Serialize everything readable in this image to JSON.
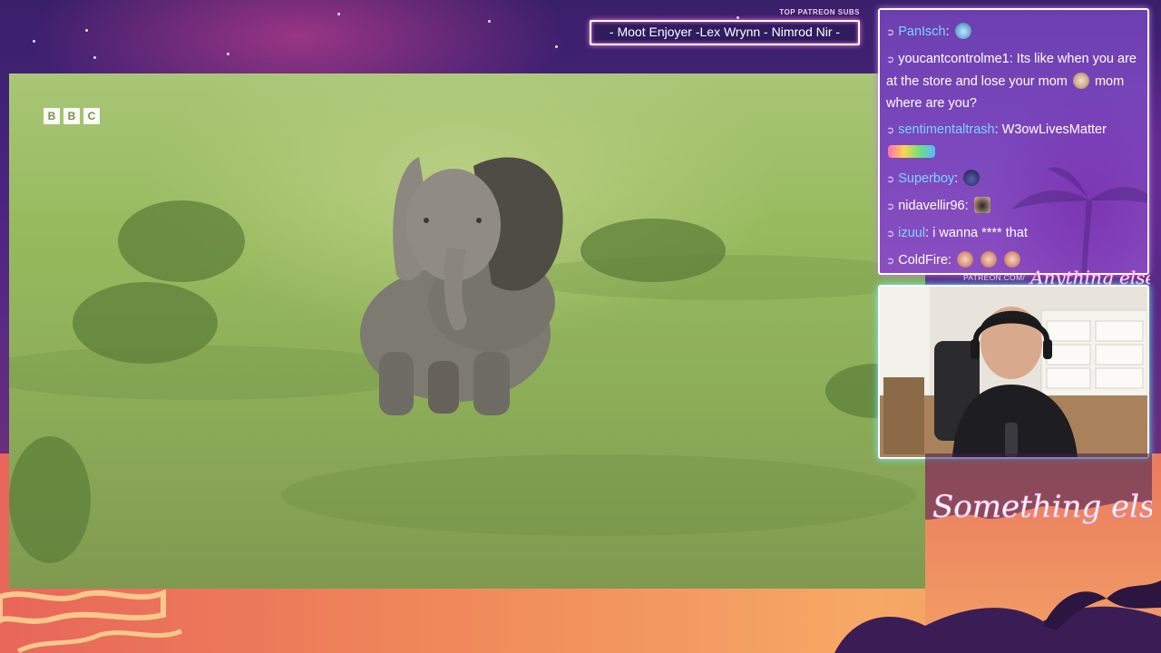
{
  "overlay": {
    "top_patreon_subs_title": "TOP PATREON SUBS",
    "top_patreon_subs_names": "- Moot Enjoyer -Lex Wrynn - Nimrod Nir -",
    "patreon_url": "PATREON.COM/",
    "anything_else_logo": "Anything else",
    "something_else_logo": "Something else"
  },
  "video": {
    "watermark": [
      "B",
      "B",
      "C"
    ]
  },
  "chat": {
    "messages": [
      {
        "user": "PanIsch",
        "text": "",
        "user_color": "#7ad4ff",
        "emotes": [
          "emote-blue-face"
        ]
      },
      {
        "user": "youcantcontrolme1",
        "text": "Its like when you are at the store and lose your mom",
        "text_after": "mom where are you?",
        "user_color": "#ffffff",
        "emotes": [
          "emote-face"
        ]
      },
      {
        "user": "sentimentaltrash",
        "text": "W3owLivesMatter",
        "user_color": "#7ad4ff",
        "emotes": [
          "emote-rainbow-banner"
        ]
      },
      {
        "user": "Superboy",
        "text": "",
        "user_color": "#7ad4ff",
        "emotes": [
          "emote-dark-hood"
        ]
      },
      {
        "user": "nidavellir96",
        "text": "",
        "user_color": "#ffffff",
        "emotes": [
          "emote-pug"
        ]
      },
      {
        "user": "izuul",
        "text": "i wanna **** that",
        "user_color": "#7ad4ff",
        "emotes": []
      },
      {
        "user": "ColdFire",
        "text": "",
        "user_color": "#ffffff",
        "emotes": [
          "emote-blush",
          "emote-blush",
          "emote-blush"
        ]
      }
    ]
  }
}
